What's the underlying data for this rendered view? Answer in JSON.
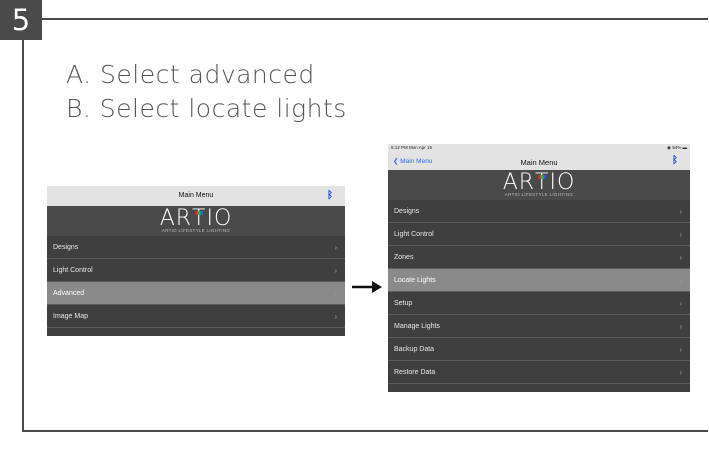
{
  "step": {
    "number": "5"
  },
  "instructions": {
    "a": "A. Select advanced",
    "b": "B. Select locate lights"
  },
  "left_screen": {
    "header_title": "Main Menu",
    "bluetooth_icon": "bluetooth-icon",
    "logo": {
      "text_pre": "AR",
      "text_t": "T",
      "text_post": "IO",
      "subtitle": "ARTIO LIFESTYLE LIGHTING"
    },
    "items": [
      {
        "label": "Designs"
      },
      {
        "label": "Light Control"
      },
      {
        "label": "Advanced"
      },
      {
        "label": "Image Map"
      }
    ],
    "selected_index": 2
  },
  "right_screen": {
    "status_left": "5:12 PM  Mon Apr 15",
    "status_right": "94%",
    "back_label": "Main Menu",
    "header_title": "Main Menu",
    "logo": {
      "text_pre": "AR",
      "text_t": "T",
      "text_post": "IO",
      "subtitle": "ARTIO LIFESTYLE LIGHTING"
    },
    "items": [
      {
        "label": "Designs"
      },
      {
        "label": "Light Control"
      },
      {
        "label": "Zones"
      },
      {
        "label": "Locate Lights"
      },
      {
        "label": "Setup"
      },
      {
        "label": "Manage Lights"
      },
      {
        "label": "Backup Data"
      },
      {
        "label": "Restore Data"
      }
    ],
    "selected_index": 3
  },
  "colors": {
    "frame": "#4a4a4a",
    "menu_bg": "#3f3f3f",
    "selected": "#8a8a8a",
    "bluetooth": "#1a4fd6",
    "logo_red": "#d62828",
    "logo_green": "#2fb34a",
    "logo_blue": "#2b5fd6"
  }
}
